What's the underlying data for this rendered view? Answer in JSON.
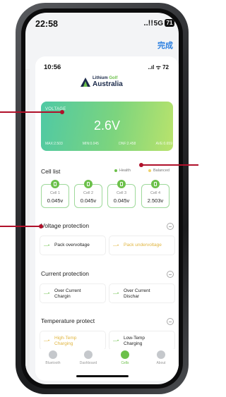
{
  "status_bar": {
    "time": "22:58",
    "signal": "..!!",
    "network": "5G",
    "battery": "71"
  },
  "header": {
    "done_label": "完成"
  },
  "inner_status": {
    "time": "10:56",
    "icons": "..ıl ᯤ 72"
  },
  "logo": {
    "line1": "Lithium",
    "line1_accent": "Golf",
    "line2": "Australia"
  },
  "voltage_card": {
    "label": "VOLTAGE",
    "value": "2.6V",
    "stats": [
      "MAX:2.503",
      "MIN:0.045",
      "DNF:2.458",
      "AVE:0.659"
    ]
  },
  "cell_list": {
    "title": "Cell list",
    "legend": [
      {
        "label": "Health",
        "color": "#6cc04a"
      },
      {
        "label": "Balanced",
        "color": "#f0d36c"
      }
    ],
    "cells": [
      {
        "name": "Cell 1",
        "value": "0.045v"
      },
      {
        "name": "Cell 2",
        "value": "0.045v"
      },
      {
        "name": "Cell 3",
        "value": "0.045v"
      },
      {
        "name": "Cell 4",
        "value": "2.503v"
      }
    ]
  },
  "voltage_protection": {
    "title": "Voltage protection",
    "items": [
      {
        "label": "Pack overvoltage",
        "state": "ok"
      },
      {
        "label": "Pack undervoltage",
        "state": "warn"
      }
    ]
  },
  "current_protection": {
    "title": "Current protection",
    "items": [
      {
        "line1": "Over Current",
        "line2": "Chargin",
        "state": "ok"
      },
      {
        "line1": "Over Current",
        "line2": "Dischar",
        "state": "ok"
      }
    ]
  },
  "temperature_protection": {
    "title": "Temperature protect",
    "items": [
      {
        "line1": "High-Temp",
        "line2": "Charging",
        "state": "warn"
      },
      {
        "line1": "Low-Temp",
        "line2": "Charging",
        "state": "ok"
      }
    ]
  },
  "tabs": [
    {
      "label": "Bluetooth",
      "icon": "bluetooth-icon",
      "active": false
    },
    {
      "label": "Dashboard",
      "icon": "dashboard-icon",
      "active": false
    },
    {
      "label": "Cells",
      "icon": "cells-icon",
      "active": true
    },
    {
      "label": "About",
      "icon": "about-icon",
      "active": false
    }
  ],
  "colors": {
    "accent": "#6cc04a",
    "warning": "#e0b53e",
    "callout": "#b0102a",
    "link": "#2b7fe0"
  }
}
